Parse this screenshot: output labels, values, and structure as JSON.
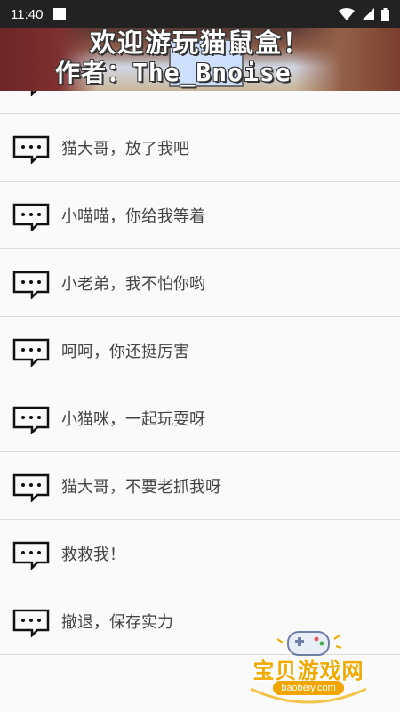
{
  "status_bar": {
    "time": "11:40",
    "icons": [
      "notification-icon",
      "wifi-icon",
      "signal-icon",
      "battery-icon"
    ]
  },
  "banner": {
    "line1": "欢迎游玩猫鼠盒！",
    "line2": "作者：The_Bnoise"
  },
  "list": {
    "items": [
      {
        "label": ""
      },
      {
        "label": "猫大哥，放了我吧"
      },
      {
        "label": "小喵喵，你给我等着"
      },
      {
        "label": "小老弟，我不怕你哟"
      },
      {
        "label": "呵呵，你还挺厉害"
      },
      {
        "label": "小猫咪，一起玩耍呀"
      },
      {
        "label": "猫大哥，不要老抓我呀"
      },
      {
        "label": "救救我！"
      },
      {
        "label": "撤退，保存实力"
      }
    ]
  },
  "watermark": {
    "title": "宝贝游戏网",
    "url": "baobeiy.com"
  }
}
